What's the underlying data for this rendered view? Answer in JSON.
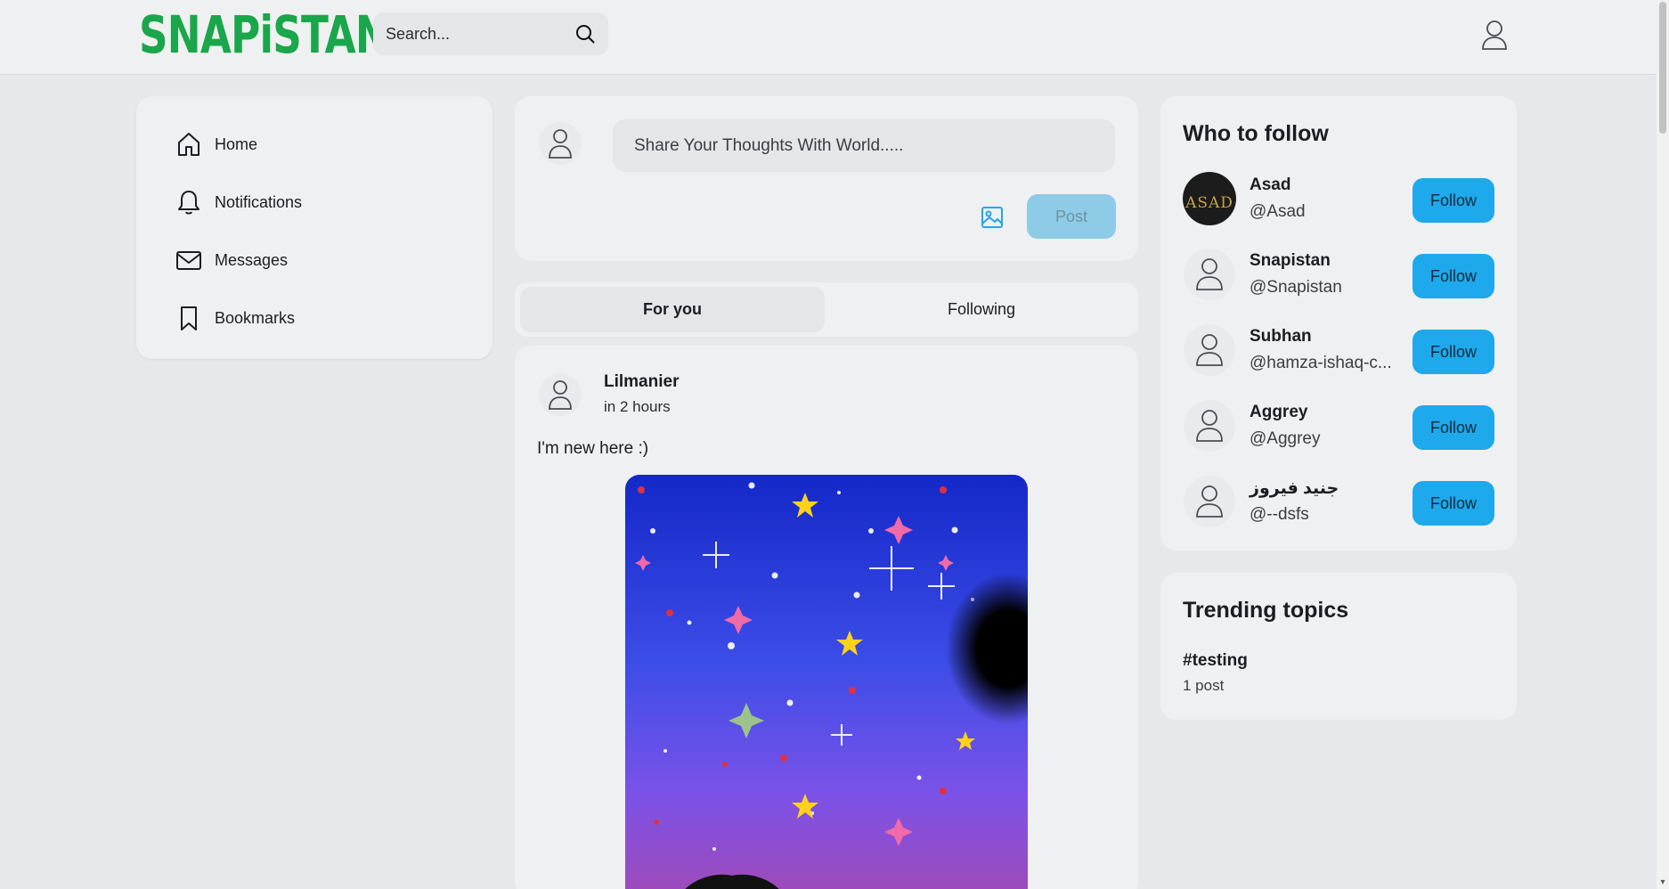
{
  "header": {
    "logo_text": "SNAPiSTAN",
    "brand_color": "#1aa64a",
    "search_placeholder": "Search..."
  },
  "nav": {
    "items": [
      {
        "label": "Home",
        "icon": "home-icon"
      },
      {
        "label": "Notifications",
        "icon": "bell-icon"
      },
      {
        "label": "Messages",
        "icon": "mail-icon"
      },
      {
        "label": "Bookmarks",
        "icon": "bookmark-icon"
      }
    ]
  },
  "composer": {
    "placeholder": "Share Your Thoughts With World.....",
    "post_label": "Post"
  },
  "tabs": [
    {
      "label": "For you",
      "active": true
    },
    {
      "label": "Following",
      "active": false
    }
  ],
  "post": {
    "author": "Lilmanier",
    "time": "in 2 hours",
    "text": "I'm new here :)"
  },
  "who_to_follow": {
    "title": "Who to follow",
    "button_label": "Follow",
    "accent": "#1da9ec",
    "users": [
      {
        "name": "Asad",
        "handle": "@Asad",
        "avatar_text": "ASAD"
      },
      {
        "name": "Snapistan",
        "handle": "@Snapistan"
      },
      {
        "name": "Subhan",
        "handle": "@hamza-ishaq-c..."
      },
      {
        "name": "Aggrey",
        "handle": "@Aggrey"
      },
      {
        "name": "جنید فیروز",
        "handle": "@--dsfs"
      }
    ]
  },
  "trending": {
    "title": "Trending topics",
    "topics": [
      {
        "tag": "#testing",
        "count": "1 post"
      }
    ]
  }
}
